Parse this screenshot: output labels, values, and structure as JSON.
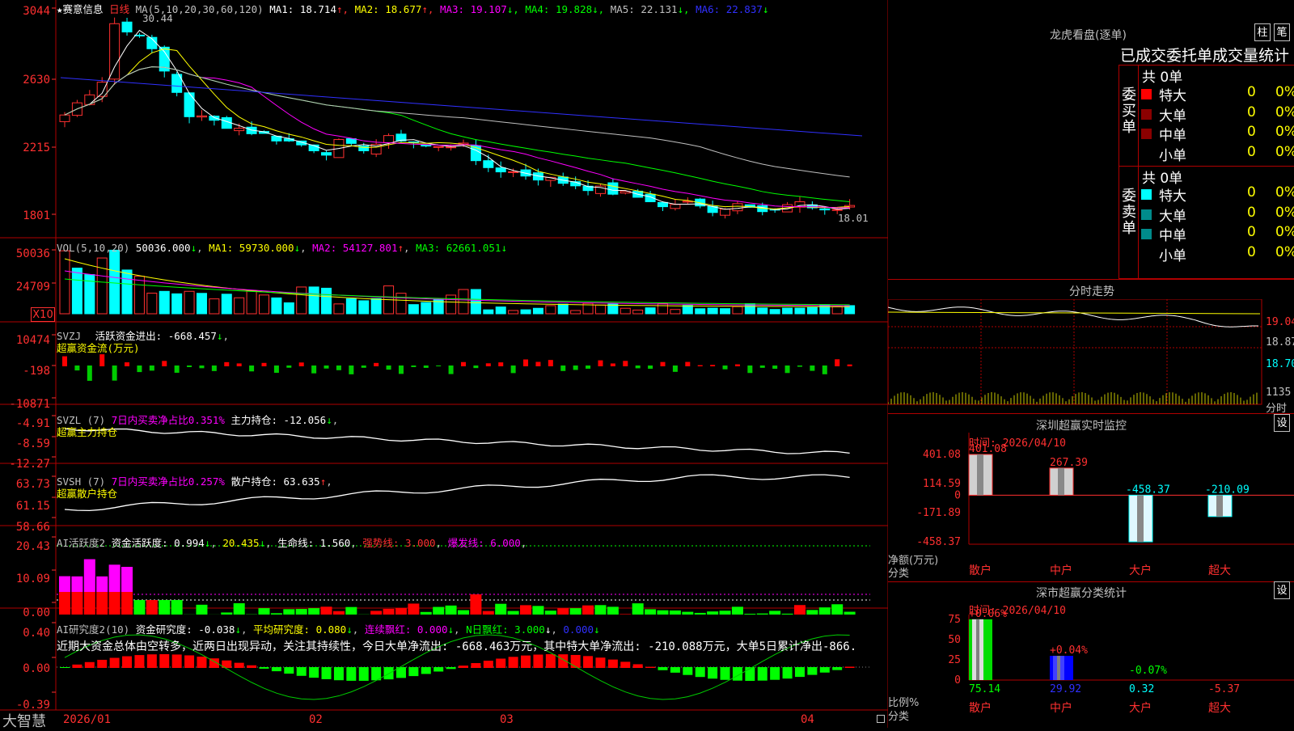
{
  "stock": {
    "name": "赛意信息",
    "period": "日线",
    "ma_params": "MA(5,10,20,30,60,120)"
  },
  "ma_legend": [
    {
      "label": "MA1: 18.714",
      "arrow": "↑",
      "color": "#ffffff"
    },
    {
      "label": "MA2: 18.677",
      "arrow": "↑",
      "color": "#ffff00"
    },
    {
      "label": "MA3: 19.107",
      "arrow": "↓",
      "color": "#ff00ff"
    },
    {
      "label": "MA4: 19.828",
      "arrow": "↓",
      "color": "#00ff00"
    },
    {
      "label": "MA5: 22.131",
      "arrow": "↓",
      "color": "#c0c0c0"
    },
    {
      "label": "MA6: 22.837",
      "arrow": "↓",
      "color": "#3030ff"
    }
  ],
  "price_axis": [
    "3044",
    "2630",
    "2215",
    "1801"
  ],
  "price_notes": {
    "high": "30.44",
    "low": "18.01"
  },
  "vol": {
    "title": "VOL(5,10,20)",
    "value": "50036.000",
    "ma1": "MA1: 59730.000",
    "ma2": "MA2: 54127.801",
    "ma3": "MA3: 62661.051",
    "axis": [
      "50036",
      "24709"
    ],
    "unit": "X10"
  },
  "svzj": {
    "title": "SVZJ",
    "legend": "活跃资金进出: -668.457",
    "sub": "超赢资金流(万元)",
    "axis": [
      "10474",
      "-198",
      "-10871"
    ]
  },
  "svzl": {
    "title": "SVZL (7)",
    "legend1": "7日内买卖净占比0.351%",
    "legend2": "主力持仓: -12.056",
    "sub": "超赢主力持仓",
    "axis": [
      "-4.91",
      "-8.59",
      "-12.27"
    ]
  },
  "svsh": {
    "title": "SVSH (7)",
    "legend1": "7日内买卖净占比0.257%",
    "legend2": "散户持仓: 63.635",
    "sub": "超赢散户持仓",
    "axis": [
      "63.73",
      "61.15",
      "58.66"
    ]
  },
  "ai_active": {
    "title": "AI活跃度2",
    "l1": "资金活跃度: 0.994",
    "l2": "20.435",
    "l3": "生命线: 1.560",
    "l4": "强势线: 3.000",
    "l5": "爆发线: 6.000",
    "axis": [
      "20.43",
      "10.09",
      "0.00"
    ]
  },
  "ai_research": {
    "title": "AI研究度2(10)",
    "l1": "资金研究度: -0.038",
    "l2": "平均研究度: 0.080",
    "l3": "连续飘红: 0.000",
    "l4": "N日飘红: 3.000",
    "l5": "0.000",
    "axis": [
      "0.40",
      "0.00",
      "-0.39"
    ],
    "commentary": "近期大资金总体由空转多，近两日出现异动，关注其持续性，今日大单净流出: -668.463万元，其中特大单净流出: -210.088万元，大单5日累计净出-866."
  },
  "xaxis": {
    "labels": [
      "2026/01",
      "02",
      "03",
      "04"
    ]
  },
  "brand": "大智慧",
  "dragon": {
    "title": "龙虎看盘(逐单)",
    "btn1": "柱",
    "btn2": "笔",
    "tabs": "已成交委托单成交量统计",
    "buy_label": "委买单",
    "sell_label": "委卖单",
    "buy_total": "共 0单",
    "sell_total": "共 0单",
    "rows": [
      "特大",
      "大单",
      "中单",
      "小单"
    ],
    "val": "0",
    "pct": "0%"
  },
  "fenshi": {
    "title": "分时走势",
    "axis": [
      "19.04",
      "18.87",
      "18.70",
      "1135",
      "分时"
    ]
  },
  "sz_monitor": {
    "title": "深圳超赢实时监控",
    "btn": "设",
    "time": "时间: 2026/04/10",
    "axis": [
      "401.08",
      "114.59",
      "0",
      "-171.89",
      "-458.37"
    ],
    "ylabel": "净额(万元)",
    "xlabel": "分类",
    "cats": [
      "散户",
      "中户",
      "大户",
      "超大"
    ],
    "values": [
      "401.08",
      "267.39",
      "-458.37",
      "-210.09"
    ]
  },
  "sz_class": {
    "title": "深市超赢分类统计",
    "btn": "设",
    "time": "时间: 2026/04/10",
    "axis": [
      "75",
      "50",
      "25",
      "0"
    ],
    "ylabel": "比例%",
    "xlabel": "分类",
    "cats": [
      "散户",
      "中户",
      "大户",
      "超大"
    ],
    "top": [
      "+0.06%",
      "+0.04%",
      "-0.07%",
      ""
    ],
    "bottom": [
      "75.14",
      "29.92",
      "0.32",
      "-5.37"
    ]
  },
  "colors": {
    "up": "#ff3030",
    "down": "#00ffff",
    "border": "#b00000",
    "label": "#ffff00"
  }
}
